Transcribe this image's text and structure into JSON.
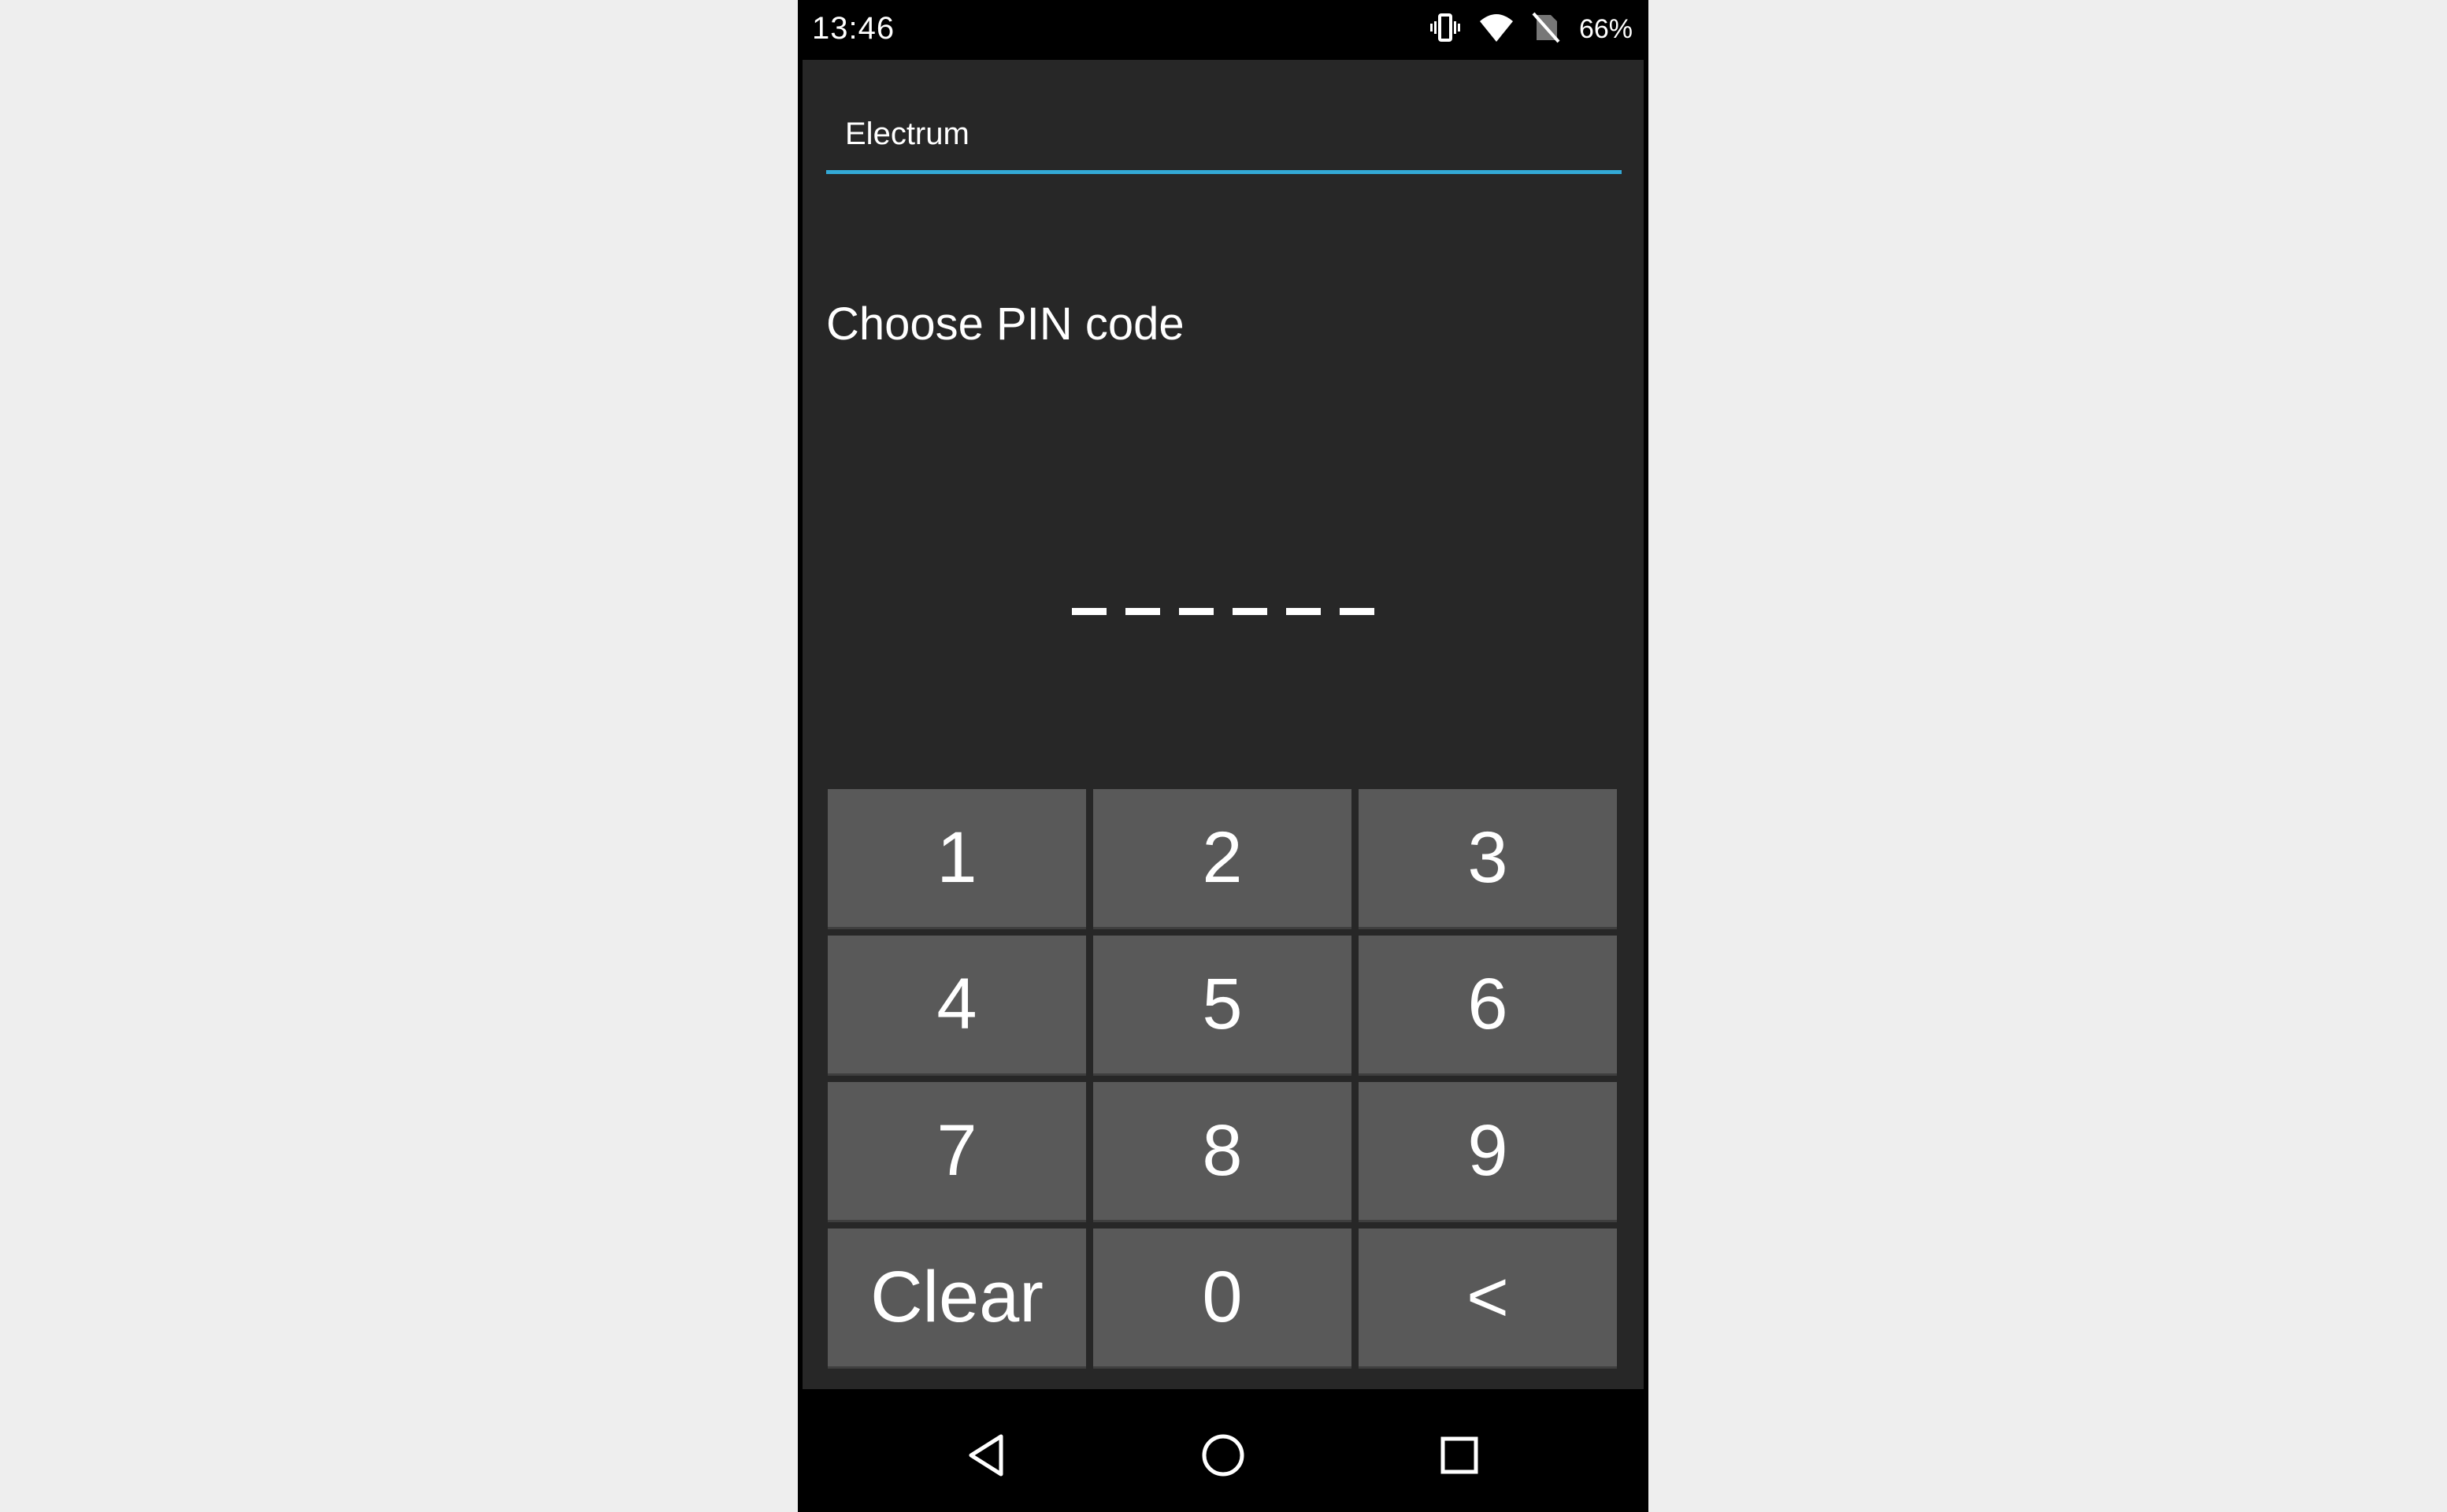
{
  "status_bar": {
    "time": "13:46",
    "battery": "66%",
    "icons": [
      "vibrate-icon",
      "wifi-icon",
      "no-sim-icon"
    ]
  },
  "app": {
    "title": "Electrum",
    "accent_color": "#33a9d6",
    "prompt": "Choose PIN code",
    "pin_placeholder_count": 6,
    "pin_placeholder_char": "_"
  },
  "keypad": {
    "keys": [
      {
        "label": "1"
      },
      {
        "label": "2"
      },
      {
        "label": "3"
      },
      {
        "label": "4"
      },
      {
        "label": "5"
      },
      {
        "label": "6"
      },
      {
        "label": "7"
      },
      {
        "label": "8"
      },
      {
        "label": "9"
      },
      {
        "label": "Clear"
      },
      {
        "label": "0"
      },
      {
        "label": "<"
      }
    ]
  },
  "nav_bar": {
    "buttons": [
      "back-icon",
      "home-icon",
      "recents-icon"
    ]
  }
}
